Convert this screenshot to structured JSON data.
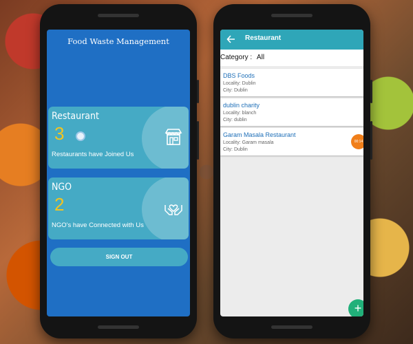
{
  "dashboard": {
    "title": "Food Waste Management",
    "restaurant_card": {
      "title": "Restaurant",
      "count": "3",
      "subtitle": "Restaurants have Joined Us",
      "icon": "storefront-icon"
    },
    "ngo_card": {
      "title": "NGO",
      "count": "2",
      "subtitle": "NGO's have Connected with Us",
      "icon": "helping-hands-icon"
    },
    "signout_label": "SIGN OUT"
  },
  "restaurant_list": {
    "title": "Restaurant",
    "category_label": "Category :",
    "category_value": "All",
    "items": [
      {
        "name": "DBS Foods",
        "locality": "Locality: Dublin",
        "city": "City: Dublin"
      },
      {
        "name": "dublin charity",
        "locality": "Locality: blanch",
        "city": "City: dublin"
      },
      {
        "name": "Garam Masala Restaurant",
        "locality": "Locality: Garam masala",
        "city": "City: Dublin"
      }
    ],
    "timer_badge": "00:14",
    "fab_label": "+"
  },
  "colors": {
    "primary_blue": "#1f6fc4",
    "card_teal": "#45aac5",
    "appbar_teal": "#2fa6b8",
    "count_yellow": "#f3c41f",
    "fab_green": "#21b07a",
    "timer_orange": "#f07f1a"
  }
}
